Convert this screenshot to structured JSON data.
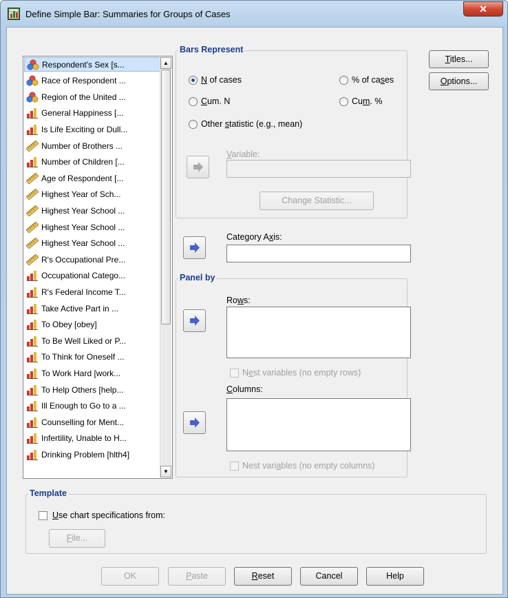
{
  "window": {
    "title": "Define Simple Bar: Summaries for Groups of Cases",
    "close_glyph": "✕"
  },
  "variables": [
    {
      "label": "Respondent's Sex [s...",
      "icon": "nominal"
    },
    {
      "label": "Race of Respondent ...",
      "icon": "nominal"
    },
    {
      "label": "Region of the United ...",
      "icon": "nominal"
    },
    {
      "label": "General Happiness [...",
      "icon": "ordinal"
    },
    {
      "label": "Is Life Exciting or Dull...",
      "icon": "ordinal"
    },
    {
      "label": "Number of Brothers ...",
      "icon": "scale"
    },
    {
      "label": "Number of Children [...",
      "icon": "ordinal"
    },
    {
      "label": "Age of Respondent [...",
      "icon": "scale"
    },
    {
      "label": "Highest Year of Sch...",
      "icon": "scale"
    },
    {
      "label": "Highest Year School ...",
      "icon": "scale"
    },
    {
      "label": "Highest Year School ...",
      "icon": "scale"
    },
    {
      "label": "Highest Year School ...",
      "icon": "scale"
    },
    {
      "label": "R's Occupational Pre...",
      "icon": "scale"
    },
    {
      "label": "Occupational Catego...",
      "icon": "ordinal"
    },
    {
      "label": "R's Federal Income T...",
      "icon": "ordinal"
    },
    {
      "label": "Take Active Part in ...",
      "icon": "ordinal"
    },
    {
      "label": "To Obey [obey]",
      "icon": "ordinal"
    },
    {
      "label": "To Be Well Liked or P...",
      "icon": "ordinal"
    },
    {
      "label": "To Think for Oneself ...",
      "icon": "ordinal"
    },
    {
      "label": "To Work Hard [work...",
      "icon": "ordinal"
    },
    {
      "label": "To Help Others [help...",
      "icon": "ordinal"
    },
    {
      "label": "Ill Enough to Go to a ...",
      "icon": "ordinal"
    },
    {
      "label": "Counselling for Ment...",
      "icon": "ordinal"
    },
    {
      "label": "Infertility, Unable to H...",
      "icon": "ordinal"
    },
    {
      "label": "Drinking Problem [hlth4]",
      "icon": "ordinal"
    }
  ],
  "bars_represent": {
    "legend": "Bars Represent",
    "options": [
      {
        "key": "N",
        "rest": " of cases",
        "pre": "",
        "selected": true
      },
      {
        "pre": "% of ca",
        "key": "s",
        "rest": "es",
        "selected": false
      },
      {
        "pre": "",
        "key": "C",
        "rest": "um. N",
        "selected": false
      },
      {
        "pre": "Cu",
        "key": "m",
        "rest": ". %",
        "selected": false
      },
      {
        "pre": "Other ",
        "key": "s",
        "rest": "tatistic (e.g., mean)",
        "selected": false
      }
    ],
    "variable_pre": "",
    "variable_key": "V",
    "variable_rest": "ariable:",
    "change_statistic": "Change Statistic..."
  },
  "category_axis": {
    "pre": "Category A",
    "key": "x",
    "rest": "is:",
    "value": ""
  },
  "panel_by": {
    "legend": "Panel by",
    "rows_pre": "Ro",
    "rows_key": "w",
    "rows_rest": "s:",
    "nest_rows_pre": "N",
    "nest_rows_key": "e",
    "nest_rows_rest": "st variables (no empty rows)",
    "columns_pre": "",
    "columns_key": "C",
    "columns_rest": "olumns:",
    "nest_cols_pre": "Nest vari",
    "nest_cols_key": "a",
    "nest_cols_rest": "bles (no empty columns)"
  },
  "template": {
    "legend": "Template",
    "use_pre": "",
    "use_key": "U",
    "use_rest": "se chart specifications from:",
    "file_pre": "",
    "file_key": "F",
    "file_rest": "ile..."
  },
  "side_buttons": {
    "titles_key": "T",
    "titles_rest": "itles...",
    "options_key": "O",
    "options_rest": "ptions..."
  },
  "footer": {
    "ok": "OK",
    "paste_key": "P",
    "paste_rest": "aste",
    "reset_key": "R",
    "reset_rest": "eset",
    "cancel": "Cancel",
    "help": "Help"
  },
  "colors": {
    "accent_blue": "#1b3d8f",
    "arrow_blue": "#4a5fc9",
    "selection": "#cde4fa"
  }
}
